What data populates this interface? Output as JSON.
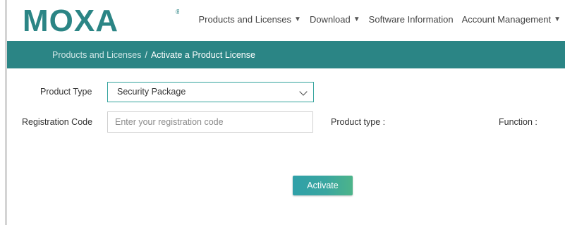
{
  "brand": {
    "name": "MOXA",
    "registered": "®",
    "color": "#2b8585"
  },
  "nav": [
    {
      "label": "Products and Licenses",
      "has_caret": true
    },
    {
      "label": "Download",
      "has_caret": true
    },
    {
      "label": "Software Information",
      "has_caret": false
    },
    {
      "label": "Account Management",
      "has_caret": true
    }
  ],
  "caret_glyph": "▼",
  "breadcrumb": {
    "parent": "Products and Licenses",
    "separator": "/",
    "current": "Activate a Product License"
  },
  "form": {
    "product_type_label": "Product Type",
    "product_type_value": "Security Package",
    "registration_code_label": "Registration Code",
    "registration_code_placeholder": "Enter your registration code",
    "registration_code_value": "",
    "product_type_info_label": "Product type :",
    "function_info_label": "Function :",
    "activate_label": "Activate"
  }
}
